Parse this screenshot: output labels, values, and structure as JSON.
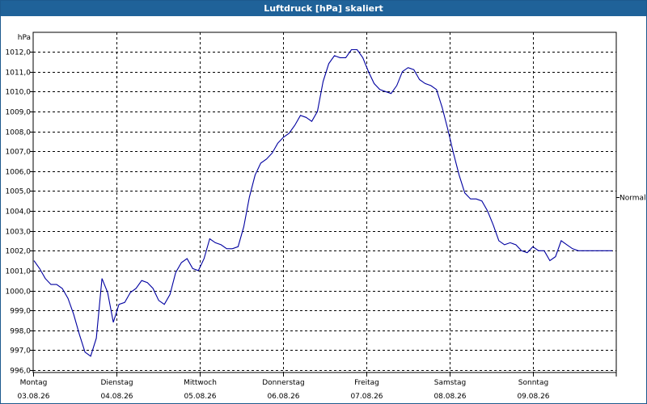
{
  "window": {
    "title": "Luftdruck [hPa] skaliert"
  },
  "colors": {
    "title_bar": "#1f6299",
    "series": "#0000a0",
    "grid": "#000000",
    "background": "#ffffff"
  },
  "chart_data": {
    "type": "line",
    "title": "Luftdruck [hPa] skaliert",
    "ylabel": "hPa",
    "ylim": [
      996.0,
      1012.5
    ],
    "yticks": [
      "996,0",
      "997,0",
      "998,0",
      "999,0",
      "1000,0",
      "1001,0",
      "1002,0",
      "1003,0",
      "1004,0",
      "1005,0",
      "1006,0",
      "1007,0",
      "1008,0",
      "1009,0",
      "1010,0",
      "1011,0",
      "1012,0"
    ],
    "ytick_values": [
      996,
      997,
      998,
      999,
      1000,
      1001,
      1002,
      1003,
      1004,
      1005,
      1006,
      1007,
      1008,
      1009,
      1010,
      1011,
      1012
    ],
    "xlim": [
      0,
      6.9
    ],
    "xticks": [
      {
        "day": "Montag",
        "date": "03.08.26"
      },
      {
        "day": "Dienstag",
        "date": "04.08.26"
      },
      {
        "day": "Mittwoch",
        "date": "05.08.26"
      },
      {
        "day": "Donnerstag",
        "date": "06.08.26"
      },
      {
        "day": "Freitag",
        "date": "07.08.26"
      },
      {
        "day": "Samstag",
        "date": "08.08.26"
      },
      {
        "day": "Sonntag",
        "date": "09.08.26"
      }
    ],
    "grid": true,
    "reference_line": {
      "label": "Normal",
      "value": 1004.7
    },
    "series": [
      {
        "x": [
          0.0,
          0.05,
          0.1,
          0.15,
          0.2,
          0.25,
          0.3,
          0.35,
          0.4,
          0.45,
          0.5,
          0.55,
          0.6,
          0.65,
          0.7,
          0.75,
          0.8,
          0.85,
          0.9,
          0.95,
          1.0,
          1.05,
          1.1,
          1.15,
          1.2,
          1.25,
          1.3,
          1.35,
          1.4,
          1.45,
          1.5,
          1.55,
          1.6,
          1.65,
          1.7,
          1.75,
          1.8,
          1.85,
          1.9,
          1.95,
          2.0,
          2.05,
          2.1,
          2.15,
          2.2,
          2.25,
          2.3,
          2.35,
          2.4,
          2.45,
          2.5,
          2.55,
          2.6,
          2.65,
          2.7,
          2.75,
          2.8,
          2.85,
          2.9,
          2.95,
          3.0,
          3.05,
          3.1,
          3.15,
          3.2,
          3.25,
          3.3,
          3.35,
          3.4,
          3.45,
          3.5,
          3.55,
          3.6,
          3.65,
          3.7,
          3.75,
          3.8,
          3.85,
          3.9,
          3.95,
          4.0,
          4.05,
          4.1,
          4.15,
          4.2,
          4.25,
          4.3,
          4.35,
          4.4,
          4.45,
          4.5,
          4.55,
          4.6,
          4.65,
          4.7,
          4.75,
          4.8,
          4.85,
          4.9,
          4.95,
          5.0,
          5.05,
          5.1,
          5.15,
          5.2,
          5.25,
          5.3,
          5.35,
          5.4,
          5.45,
          5.5,
          5.55,
          5.6,
          5.65,
          5.7,
          5.75,
          5.8,
          5.85,
          5.9,
          5.95,
          6.0,
          6.05,
          6.1,
          6.15,
          6.2,
          6.25,
          6.3,
          6.35,
          6.4,
          6.45,
          6.5,
          6.55,
          6.6,
          6.65,
          6.7,
          6.75,
          6.8,
          6.85,
          6.9
        ],
        "y": [
          1001.5,
          1001.1,
          1000.6,
          1000.3,
          1000.3,
          1000.1,
          999.6,
          998.8,
          997.8,
          996.9,
          996.7,
          997.6,
          1000.6,
          999.9,
          998.4,
          999.3,
          999.4,
          999.9,
          1000.1,
          1000.5,
          1000.4,
          1000.1,
          999.5,
          999.3,
          999.8,
          1000.9,
          1001.4,
          1001.6,
          1001.1,
          1001.0,
          1001.6,
          1002.6,
          1002.4,
          1002.3,
          1002.1,
          1002.1,
          1002.2,
          1003.2,
          1004.7,
          1005.8,
          1006.4,
          1006.6,
          1006.9,
          1007.4,
          1007.7,
          1007.9,
          1008.3,
          1008.8,
          1008.7,
          1008.5,
          1009.0,
          1010.5,
          1011.4,
          1011.8,
          1011.7,
          1011.7,
          1012.1,
          1012.1,
          1011.7,
          1011.0,
          1010.4,
          1010.1,
          1010.0,
          1009.9,
          1010.3,
          1011.0,
          1011.2,
          1011.1,
          1010.6,
          1010.4,
          1010.3,
          1010.1,
          1009.2,
          1008.1,
          1006.9,
          1005.8,
          1004.9,
          1004.6,
          1004.6,
          1004.5,
          1004.0,
          1003.3,
          1002.5,
          1002.3,
          1002.4,
          1002.3,
          1002.0,
          1001.9,
          1002.2,
          1002.0,
          1002.0,
          1001.5,
          1001.7,
          1002.5,
          1002.3,
          1002.1,
          1002.0,
          1002.0,
          1002.0,
          1002.0,
          1002.0,
          1002.0,
          1002.0,
          1002.0,
          1002.0,
          1002.0,
          1002.0,
          1002.0,
          1002.0,
          1002.0,
          1002.0,
          1002.0,
          1002.0,
          1002.0,
          1002.0,
          1002.0,
          1002.0,
          1002.0,
          1002.0,
          1002.0,
          1002.0,
          1002.0,
          1002.0,
          1002.0,
          1002.0,
          1002.0,
          1002.0,
          1002.0,
          1002.0,
          1002.0,
          1002.0,
          1002.0,
          1002.0,
          1002.0,
          1002.0,
          1002.0,
          1002.0,
          1002.0,
          1002.0
        ]
      }
    ]
  }
}
